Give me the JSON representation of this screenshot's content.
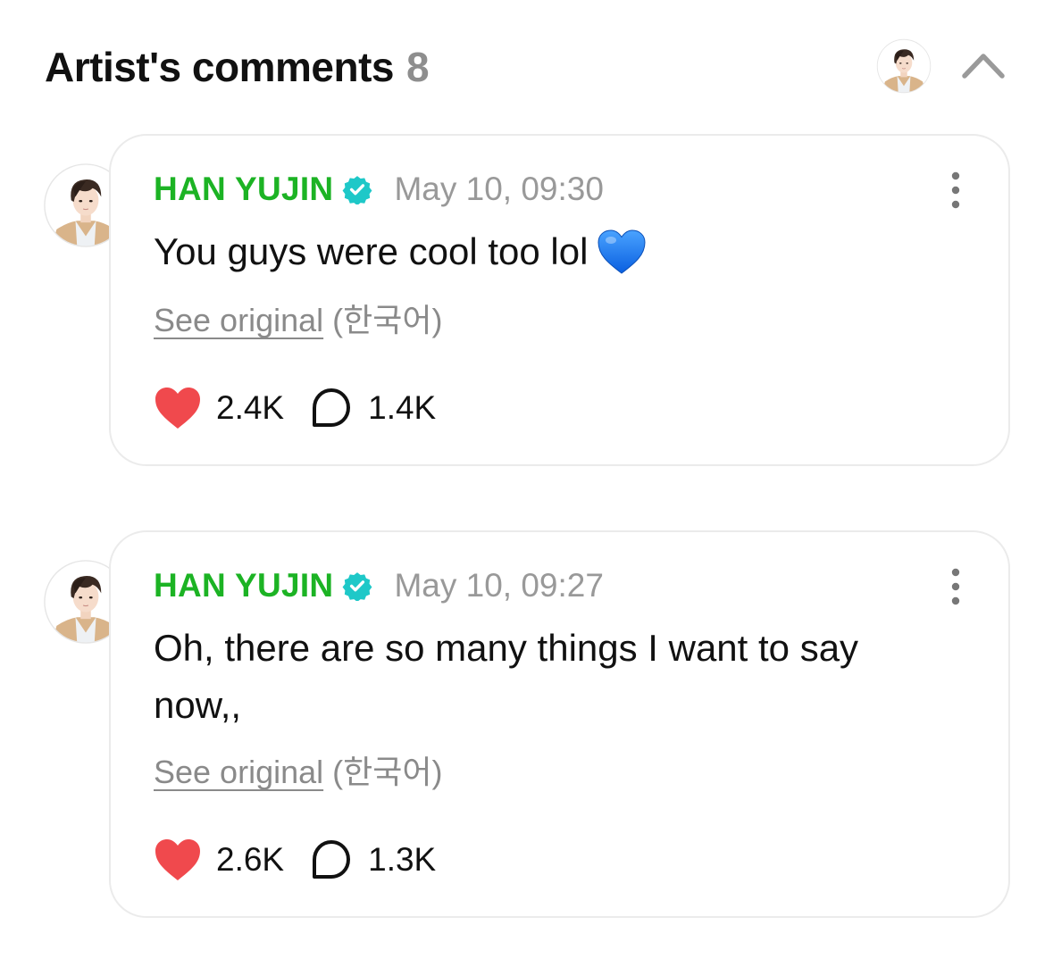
{
  "header": {
    "title": "Artist's comments",
    "count": "8"
  },
  "comments": [
    {
      "author": "HAN YUJIN",
      "timestamp": "May 10, 09:30",
      "body": "You guys were cool too lol",
      "emoji": "blue-heart",
      "see_original": "See original",
      "language": "(한국어)",
      "likes": "2.4K",
      "replies": "1.4K"
    },
    {
      "author": "HAN YUJIN",
      "timestamp": "May 10, 09:27",
      "body": "Oh, there are so many things I want to say now,,",
      "see_original": "See original",
      "language": "(한국어)",
      "likes": "2.6K",
      "replies": "1.3K"
    }
  ],
  "colors": {
    "author": "#1cb324",
    "verified": "#1ec8c8",
    "like": "#f0494d",
    "muted": "#8a8a8a",
    "card_border": "#ebebeb"
  },
  "icons": {
    "verified": "verified-badge-icon",
    "like": "heart-icon",
    "reply": "speech-bubble-icon",
    "more": "more-vertical-icon",
    "collapse": "chevron-up-icon"
  }
}
